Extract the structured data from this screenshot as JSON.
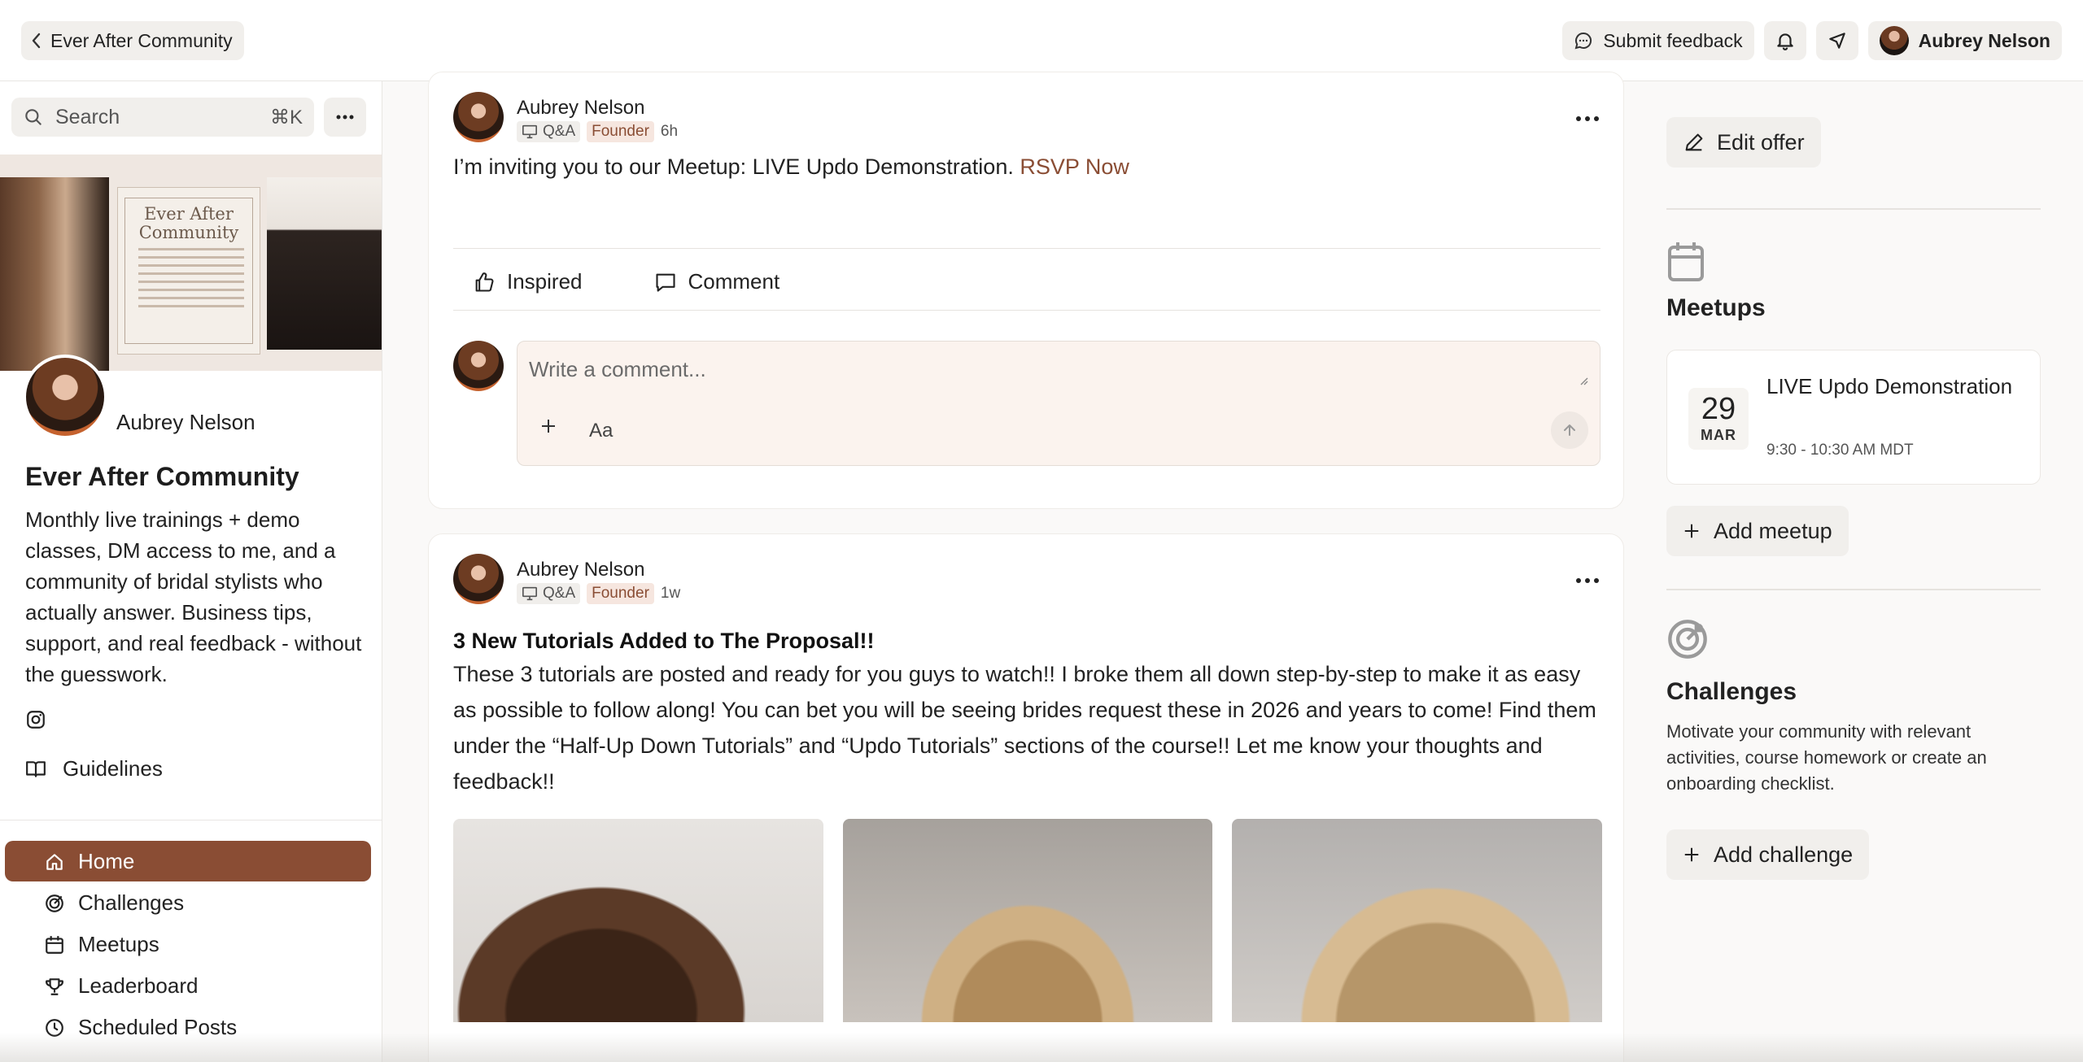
{
  "topbar": {
    "back_label": "Ever After Community",
    "submit_feedback": "Submit feedback",
    "user_name": "Aubrey Nelson"
  },
  "sidebar": {
    "search_placeholder": "Search",
    "search_shortcut": "⌘K",
    "banner": {
      "title": "Ever After Community"
    },
    "owner_name": "Aubrey Nelson",
    "community_title": "Ever After Community",
    "description": "Monthly live trainings + demo classes, DM access to me, and a community of bridal stylists who actually answer. Business tips, support, and real feedback - without the guesswork.",
    "guidelines": "Guidelines",
    "nav": [
      {
        "label": "Home",
        "icon": "home-icon",
        "active": true
      },
      {
        "label": "Challenges",
        "icon": "target-icon"
      },
      {
        "label": "Meetups",
        "icon": "calendar-icon"
      },
      {
        "label": "Leaderboard",
        "icon": "trophy-icon"
      },
      {
        "label": "Scheduled Posts",
        "icon": "clock-icon"
      }
    ]
  },
  "posts": [
    {
      "author": "Aubrey Nelson",
      "category": "Q&A",
      "badge": "Founder",
      "time": "6h",
      "text": "I’m inviting you to our Meetup: LIVE Updo Demonstration. ",
      "link": "RSVP Now",
      "like_label": "Inspired",
      "comment_label": "Comment",
      "comment_placeholder": "Write a comment...",
      "format_label": "Aa"
    },
    {
      "author": "Aubrey Nelson",
      "category": "Q&A",
      "badge": "Founder",
      "time": "1w",
      "title": "3 New Tutorials Added to The Proposal!!",
      "body": "These 3 tutorials are posted and ready for you guys to watch!! I broke them all down step-by-step to make it as easy as possible to follow along! You can bet you will be seeing brides request these in 2026 and years to come! Find them under the “Half-Up Down Tutorials” and “Updo Tutorials” sections of the course!! Let me know your thoughts and feedback!!"
    }
  ],
  "right": {
    "edit_offer": "Edit offer",
    "meetups_heading": "Meetups",
    "meetup": {
      "day": "29",
      "month": "MAR",
      "title": "LIVE Updo Demonstration",
      "time": "9:30 - 10:30 AM MDT"
    },
    "add_meetup": "Add meetup",
    "challenges_heading": "Challenges",
    "challenges_desc": "Motivate your community with relevant activities, course homework or create an onboarding checklist.",
    "add_challenge": "Add challenge"
  },
  "colors": {
    "accent": "#8a4d34",
    "link": "#8a4d34",
    "founder_badge_bg": "#f6e6df"
  }
}
